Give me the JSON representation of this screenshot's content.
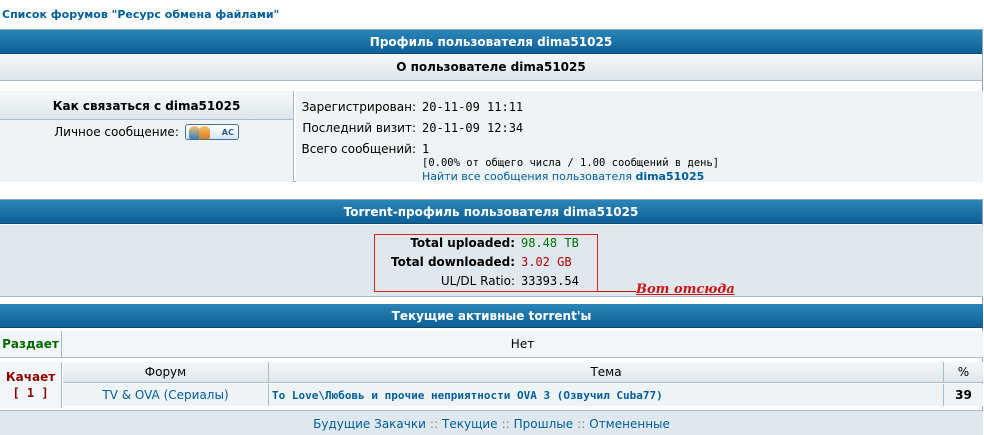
{
  "breadcrumb": "Список форумов \"Ресурс обмена файлами\"",
  "profile": {
    "header": "Профиль пользователя dima51025",
    "about": "О пользователе dima51025",
    "contact_header": "Как связаться с dima51025",
    "pm_label": "Личное сообщение:",
    "pm_button": "AC",
    "registered_label": "Зарегистрирован:",
    "registered_value": "20-11-09 11:11",
    "last_visit_label": "Последний визит:",
    "last_visit_value": "20-11-09 12:34",
    "posts_label": "Всего сообщений:",
    "posts_value": "1",
    "posts_stats": "[0.00% от общего числа / 1.00 сообщений в день]",
    "find_posts_prefix": "Найти все сообщения пользователя ",
    "find_posts_user": "dima51025"
  },
  "torrent": {
    "header": "Torrent-профиль пользователя dima51025",
    "uploaded_label": "Total uploaded:",
    "uploaded_value": "98.48 TB",
    "downloaded_label": "Total downloaded:",
    "downloaded_value": "3.02 GB",
    "ratio_label": "UL/DL Ratio:",
    "ratio_value": "33393.54",
    "annotation": "Вот отсюда",
    "active_header": "Текущие активные torrent'ы",
    "seeding_label": "Раздает",
    "seeding_value": "Нет",
    "leeching_label": "Качает",
    "leeching_count": "[ 1 ]",
    "col_forum": "Форум",
    "col_topic": "Тема",
    "col_pct": "%",
    "row_forum": "TV & OVA (Сериалы)",
    "row_topic": "To Love\\Любовь и прочие неприятности OVA 3 (Озвучил Cuba77)",
    "row_pct": "39",
    "footer_links": [
      "Будущие Закачки",
      "Текущие",
      "Прошлые",
      "Отмененные"
    ],
    "footer_sep": "::"
  },
  "colors": {
    "header_blue": "#0e5f96",
    "link": "#005e9a",
    "uploaded": "#007000",
    "downloaded": "#b00000",
    "annotation": "#c81414"
  }
}
